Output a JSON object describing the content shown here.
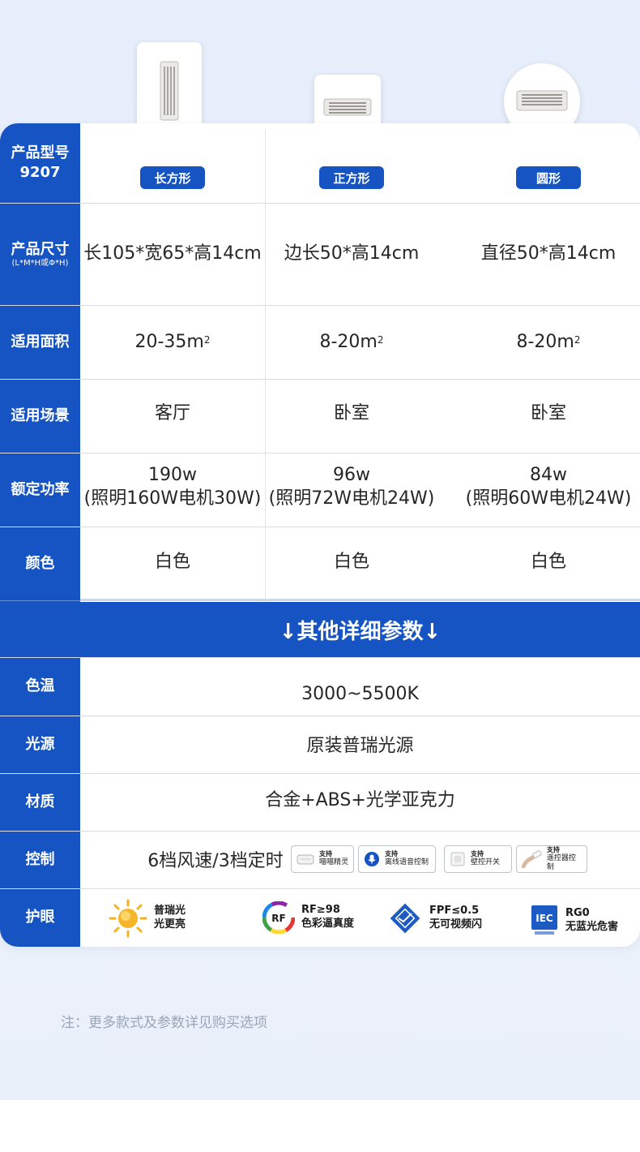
{
  "header": {
    "model_label": "产品型号",
    "model_number": "9207",
    "shapes": [
      "长方形",
      "正方形",
      "圆形"
    ]
  },
  "rows": {
    "size": {
      "label": "产品尺寸",
      "sub": "(L*M*H或Φ*H)",
      "values": [
        "长105*宽65*高14cm",
        "边长50*高14cm",
        "直径50*高14cm"
      ]
    },
    "area": {
      "label": "适用面积",
      "values": [
        "20-35m",
        "8-20m",
        "8-20m"
      ],
      "sup": "2"
    },
    "scene": {
      "label": "适用场景",
      "values": [
        "客厅",
        "卧室",
        "卧室"
      ]
    },
    "power": {
      "label": "额定功率",
      "values": [
        {
          "main": "190w",
          "detail": "(照明160W电机30W)"
        },
        {
          "main": "96w",
          "detail": "(照明72W电机24W)"
        },
        {
          "main": "84w",
          "detail": "(照明60W电机24W)"
        }
      ]
    },
    "color": {
      "label": "颜色",
      "values": [
        "白色",
        "白色",
        "白色"
      ]
    }
  },
  "banner": {
    "text": "↓其他详细参数↓"
  },
  "details": {
    "temp": {
      "label": "色温",
      "value": "3000~5500K"
    },
    "source": {
      "label": "光源",
      "value": "原装普瑞光源"
    },
    "material": {
      "label": "材质",
      "value": "合金+ABS+光学亚克力"
    },
    "control": {
      "label": "控制",
      "value": "6档风速/3档定时",
      "badges": [
        {
          "top": "支持",
          "bottom": "喵喵精灵",
          "icon": "smart-speaker-icon"
        },
        {
          "top": "支持",
          "bottom": "离线语音控制",
          "icon": "microphone-icon"
        },
        {
          "top": "支持",
          "bottom": "壁控开关",
          "icon": "wall-switch-icon"
        },
        {
          "top": "支持",
          "bottom": "遥控器控制",
          "icon": "remote-control-icon"
        }
      ]
    },
    "eye": {
      "label": "护眼",
      "features": [
        {
          "line1": "普瑞光",
          "line2": "光更亮",
          "icon": "sun-icon"
        },
        {
          "line1": "RF≥98",
          "line2": "色彩逼真度",
          "icon": "rf-icon",
          "badge": "RF"
        },
        {
          "line1": "FPF≤0.5",
          "line2": "无可视频闪",
          "icon": "flicker-free-icon"
        },
        {
          "line1": "RG0",
          "line2": "无蓝光危害",
          "icon": "iec-icon",
          "badge": "IEC"
        }
      ]
    }
  },
  "footer": {
    "note": "注：更多款式及参数详见购买选项"
  },
  "colors": {
    "primary": "#1554c2",
    "background": "#eaf0fa"
  }
}
